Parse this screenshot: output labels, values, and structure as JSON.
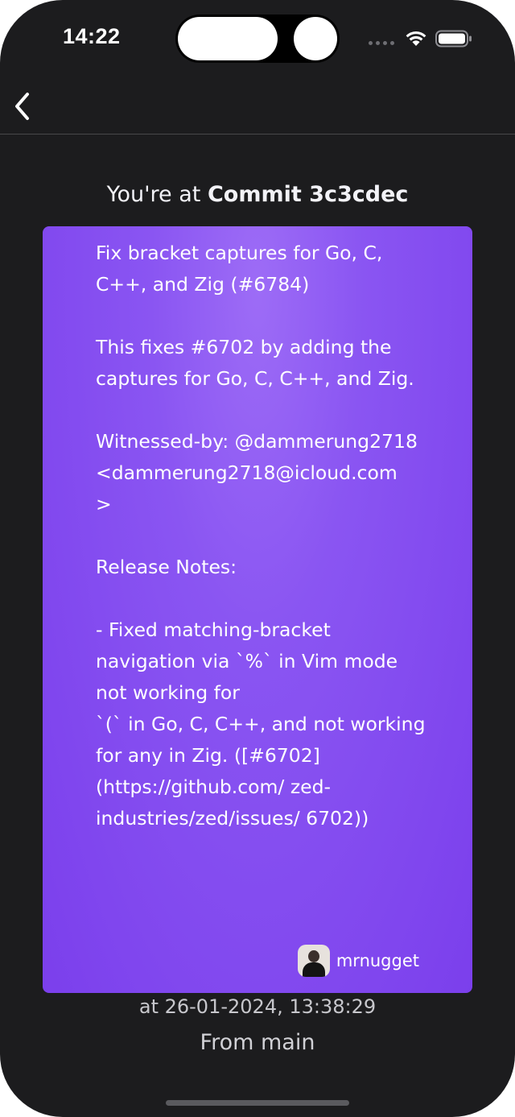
{
  "status_bar": {
    "time": "14:22"
  },
  "nav": {
    "back_icon": "chevron-left-icon"
  },
  "heading": {
    "prefix": "You're at ",
    "commit": "Commit 3c3cdec"
  },
  "commit": {
    "message": "Fix bracket captures for Go, C, C++, and Zig (#6784)\n\nThis fixes #6702 by adding the captures for Go, C, C++, and Zig.\n\nWitnessed-by: @dammerung2718 <dammerung2718@icloud.com\n>\n\nRelease Notes:\n\n- Fixed matching-bracket navigation via `%` in Vim mode not working for\n`(` in Go, C, C++, and not working for any in Zig. ([#6702](https://github.com/ zed-industries/zed/issues/ 6702))",
    "author": "mrnugget",
    "date_line": "at 26-01-2024, 13:38:29",
    "branch_line": "From main"
  },
  "colors": {
    "background": "#1c1c1e",
    "card_accent": "#8a55f2",
    "text_primary": "#ffffff"
  }
}
